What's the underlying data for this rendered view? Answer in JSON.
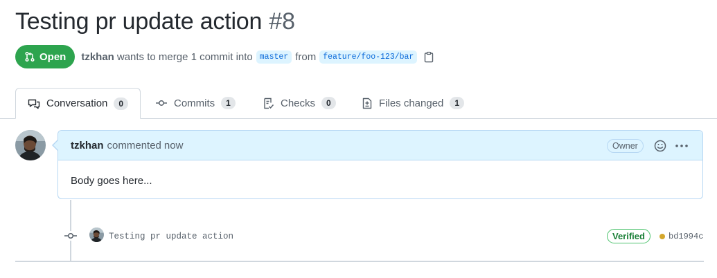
{
  "pr": {
    "title": "Testing pr update action",
    "number": "#8",
    "state": "Open",
    "author": "tzkhan",
    "merge_text": "wants to merge 1 commit into",
    "base_branch": "master",
    "from_text": "from",
    "head_branch": "feature/foo-123/bar",
    "copy_icon": "clipboard-icon"
  },
  "tabs": [
    {
      "label": "Conversation",
      "count": "0",
      "icon": "comment-discussion-icon",
      "active": true
    },
    {
      "label": "Commits",
      "count": "1",
      "icon": "git-commit-icon"
    },
    {
      "label": "Checks",
      "count": "0",
      "icon": "checklist-icon"
    },
    {
      "label": "Files changed",
      "count": "1",
      "icon": "file-diff-icon"
    }
  ],
  "comment": {
    "author": "tzkhan",
    "action": "commented",
    "time": "now",
    "badge": "Owner",
    "body": "Body goes here..."
  },
  "commit": {
    "message": "Testing pr update action",
    "verified": "Verified",
    "sha": "bd1994c",
    "status_color": "#d4a72c"
  },
  "colors": {
    "accent_green": "#2da44e",
    "link_blue": "#0969da",
    "comment_header_bg": "#ddf4ff"
  }
}
